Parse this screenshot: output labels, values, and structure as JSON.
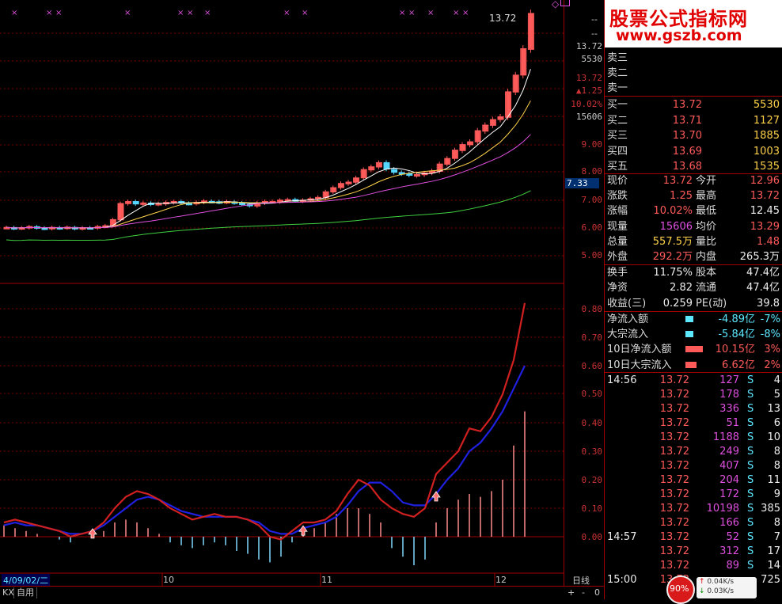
{
  "price_chart": {
    "price_axis": [
      "13.72",
      "5530",
      "13.72",
      "▲1.25",
      "10.02%",
      "15606",
      "9.00",
      "8.00",
      "7.00",
      "6.00",
      "5.00"
    ],
    "current_tag": "7.33",
    "last_price_label": "13.72",
    "dash_marks": [
      "--",
      "--"
    ]
  },
  "indicator_chart": {
    "axis": [
      "0.80",
      "0.70",
      "0.60",
      "0.50",
      "0.40",
      "0.30",
      "0.20",
      "0.10",
      "0.00"
    ]
  },
  "date_axis": {
    "start": "4/09/02/二",
    "ticks": [
      "10",
      "11",
      "12"
    ],
    "period_label": "日线"
  },
  "bottom_tabs": [
    "KX",
    "自用"
  ],
  "nav_buttons": [
    "+",
    "-",
    "0"
  ],
  "banner": {
    "title": "股票公式指标网",
    "url": "www.gszb.com"
  },
  "order_book": {
    "asks": [
      {
        "label": "卖三",
        "price": "",
        "vol": ""
      },
      {
        "label": "卖二",
        "price": "",
        "vol": ""
      },
      {
        "label": "卖一",
        "price": "",
        "vol": ""
      }
    ],
    "bids": [
      {
        "label": "买一",
        "price": "13.72",
        "vol": "5530"
      },
      {
        "label": "买二",
        "price": "13.71",
        "vol": "1127"
      },
      {
        "label": "买三",
        "price": "13.70",
        "vol": "1885"
      },
      {
        "label": "买四",
        "price": "13.69",
        "vol": "1003"
      },
      {
        "label": "买五",
        "price": "13.68",
        "vol": "1535"
      }
    ]
  },
  "quote": [
    {
      "l1": "现价",
      "v1": "13.72",
      "l2": "今开",
      "v2": "12.96"
    },
    {
      "l1": "涨跌",
      "v1": "1.25",
      "l2": "最高",
      "v2": "13.72"
    },
    {
      "l1": "涨幅",
      "v1": "10.02%",
      "l2": "最低",
      "v2": "12.45"
    },
    {
      "l1": "现量",
      "v1": "15606",
      "l2": "均价",
      "v2": "13.29"
    },
    {
      "l1": "总量",
      "v1": "557.5万",
      "l2": "量比",
      "v2": "1.48"
    },
    {
      "l1": "外盘",
      "v1": "292.2万",
      "l2": "内盘",
      "v2": "265.3万"
    }
  ],
  "fundamentals": [
    {
      "l1": "换手",
      "v1": "11.75%",
      "l2": "股本",
      "v2": "47.4亿"
    },
    {
      "l1": "净资",
      "v1": "2.82",
      "l2": "流通",
      "v2": "47.4亿"
    },
    {
      "l1": "收益(三)",
      "v1": "0.259",
      "l2": "PE(动)",
      "v2": "39.8"
    }
  ],
  "flows": [
    {
      "label": "净流入额",
      "value": "-4.89亿",
      "pct": "-7%"
    },
    {
      "label": "大宗流入",
      "value": "-5.84亿",
      "pct": "-8%"
    },
    {
      "label": "10日净流入额",
      "value": "10.15亿",
      "pct": "3%"
    },
    {
      "label": "10日大宗流入",
      "value": "6.62亿",
      "pct": "2%"
    }
  ],
  "ticks": [
    {
      "time": "14:56",
      "price": "13.72",
      "vol": "127",
      "side": "S",
      "n": "4"
    },
    {
      "time": "",
      "price": "13.72",
      "vol": "178",
      "side": "S",
      "n": "5"
    },
    {
      "time": "",
      "price": "13.72",
      "vol": "336",
      "side": "S",
      "n": "13"
    },
    {
      "time": "",
      "price": "13.72",
      "vol": "51",
      "side": "S",
      "n": "6"
    },
    {
      "time": "",
      "price": "13.72",
      "vol": "1188",
      "side": "S",
      "n": "10"
    },
    {
      "time": "",
      "price": "13.72",
      "vol": "249",
      "side": "S",
      "n": "8"
    },
    {
      "time": "",
      "price": "13.72",
      "vol": "407",
      "side": "S",
      "n": "8"
    },
    {
      "time": "",
      "price": "13.72",
      "vol": "204",
      "side": "S",
      "n": "11"
    },
    {
      "time": "",
      "price": "13.72",
      "vol": "172",
      "side": "S",
      "n": "9"
    },
    {
      "time": "",
      "price": "13.72",
      "vol": "10198",
      "side": "S",
      "n": "385"
    },
    {
      "time": "",
      "price": "13.72",
      "vol": "166",
      "side": "S",
      "n": "8"
    },
    {
      "time": "14:57",
      "price": "13.72",
      "vol": "52",
      "side": "S",
      "n": "7"
    },
    {
      "time": "",
      "price": "13.72",
      "vol": "312",
      "side": "S",
      "n": "17"
    },
    {
      "time": "",
      "price": "13.72",
      "vol": "89",
      "side": "S",
      "n": "14"
    },
    {
      "time": "15:00",
      "price": "13.72",
      "vol": "",
      "side": "",
      "n": "725"
    }
  ],
  "speed_widget": {
    "pct": "90%",
    "up": "0.04K/s",
    "down": "0.03K/s"
  },
  "colors": {
    "up": "#ff5a5a",
    "down": "#54d6ff",
    "ma5": "#ffffff",
    "ma10": "#ffd24a",
    "ma20": "#e050e0",
    "ma60": "#40d040"
  }
}
